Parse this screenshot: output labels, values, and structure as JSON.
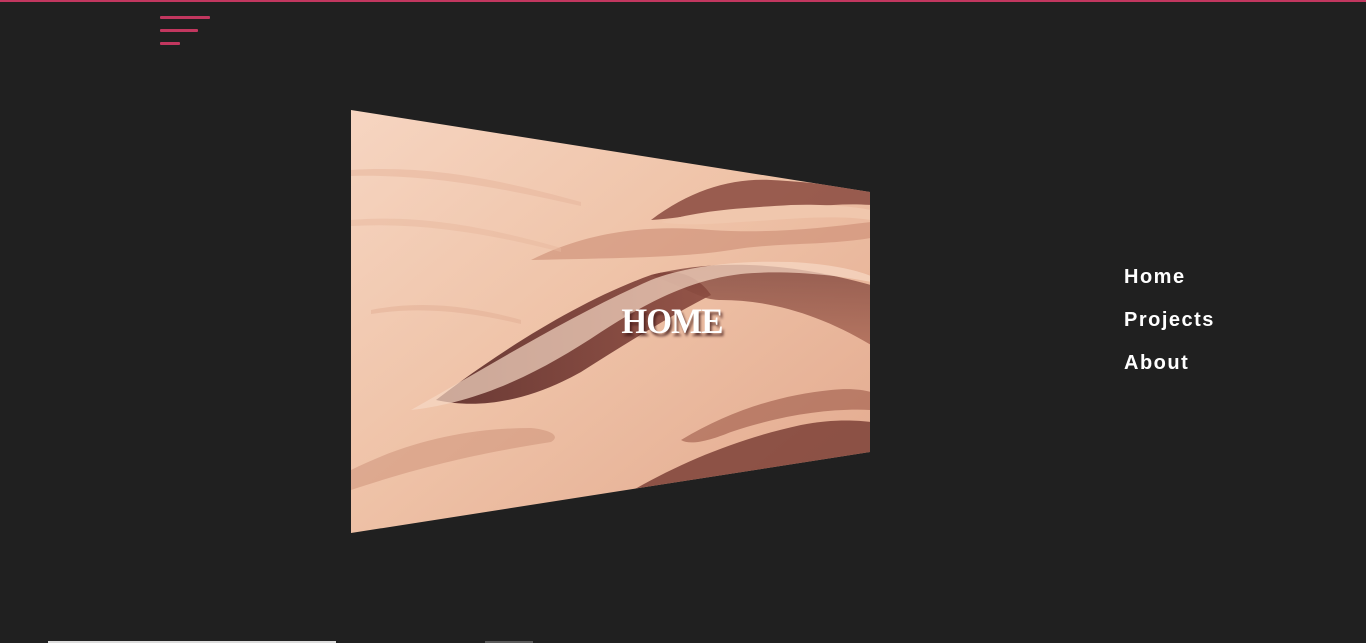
{
  "colors": {
    "background": "#202020",
    "accent": "#c2375f",
    "text": "#ffffff",
    "sand_light": "#f3cdb5",
    "sand_mid": "#e4a98f",
    "sand_shadow": "#6e3b35"
  },
  "header": {
    "menu_icon": "hamburger-menu-icon"
  },
  "hero": {
    "title": "HOME",
    "image": "desert-sand-dunes"
  },
  "nav": {
    "items": [
      {
        "label": "Home"
      },
      {
        "label": "Projects"
      },
      {
        "label": "About"
      }
    ]
  }
}
